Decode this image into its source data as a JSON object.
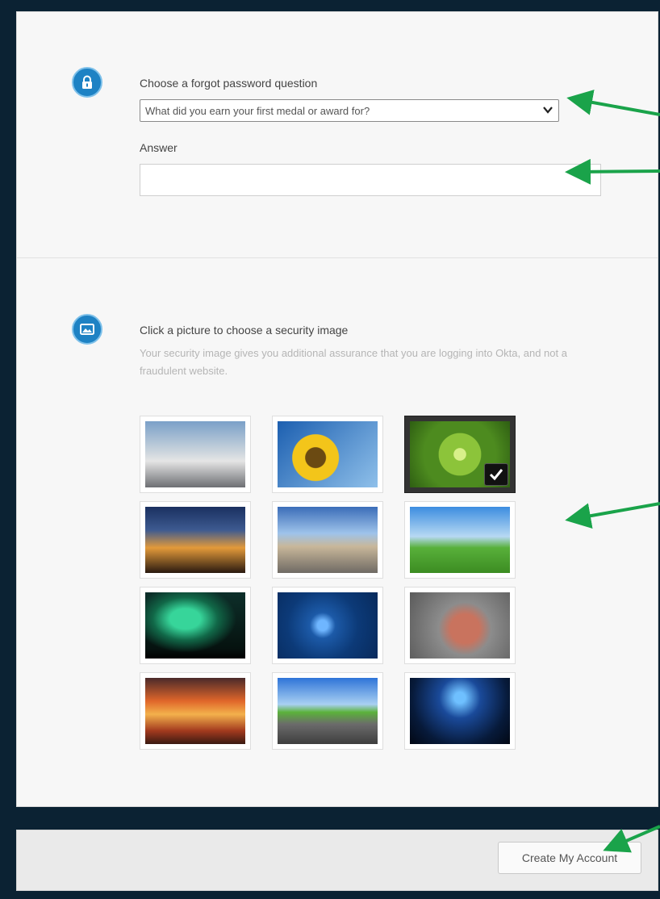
{
  "question_section": {
    "label": "Choose a forgot password question",
    "selected_question": "What did you earn your first medal or award for?",
    "answer_label": "Answer",
    "answer_value": ""
  },
  "image_section": {
    "title": "Click a picture to choose a security image",
    "description": "Your security image gives you additional assurance that you are logging into Okta, and not a fraudulent website.",
    "selected_index": 2,
    "images": [
      {
        "icon": "golden-gate-bridge-image"
      },
      {
        "icon": "sunflower-image"
      },
      {
        "icon": "green-succulent-image"
      },
      {
        "icon": "harbour-bridge-night-image"
      },
      {
        "icon": "brooklyn-bridge-image"
      },
      {
        "icon": "goats-on-meadow-image"
      },
      {
        "icon": "northern-lights-image"
      },
      {
        "icon": "blue-circuit-board-image"
      },
      {
        "icon": "red-robot-toy-image"
      },
      {
        "icon": "orange-sunset-clouds-image"
      },
      {
        "icon": "country-road-image"
      },
      {
        "icon": "stingray-image"
      }
    ]
  },
  "footer": {
    "create_button": "Create My Account"
  },
  "colors": {
    "accent": "#1e82c4",
    "annotation_arrow": "#1aa34a"
  }
}
